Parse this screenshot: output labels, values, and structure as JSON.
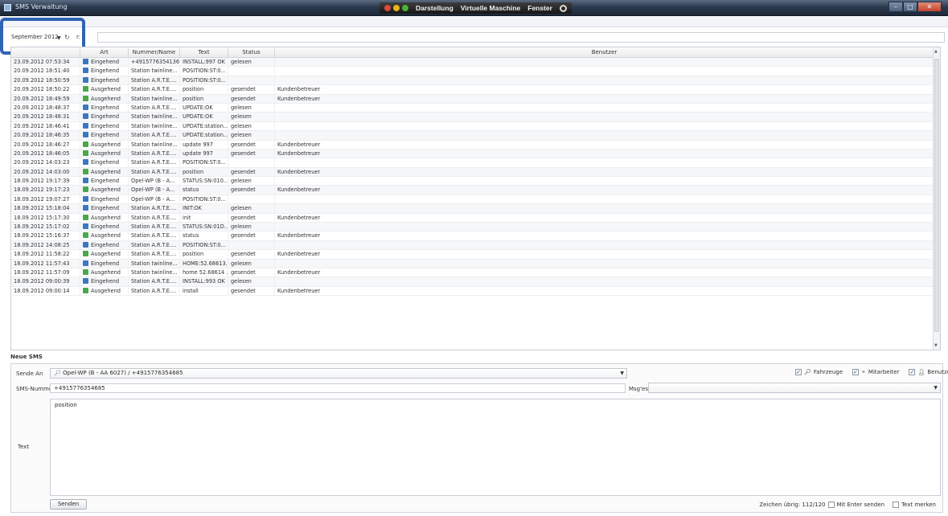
{
  "window": {
    "title": "SMS Verwaltung"
  },
  "host_menu": [
    "Darstellung",
    "Virtuelle Maschine",
    "Fenster"
  ],
  "host_menu_colors": [
    "#d84a3a",
    "#e6b21e",
    "#4caf3c"
  ],
  "filter": {
    "month": "September 2012",
    "label_partial": "r:",
    "value": ""
  },
  "table": {
    "columns": [
      "",
      "Art",
      "Nummer/Name",
      "Text",
      "Status",
      "Benutzer"
    ],
    "colors": {
      "Eingehend": "#3a78c2",
      "Ausgehend": "#4aa84c"
    },
    "rows": [
      [
        "23.09.2012 07:53:34",
        "Eingehend",
        "+4915776354136",
        "INSTALL:997 OK",
        "gelesen",
        ""
      ],
      [
        "20.09.2012 18:51:40",
        "Eingehend",
        "Station twinline...",
        "POSITION:ST:0...",
        "",
        ""
      ],
      [
        "20.09.2012 18:50:59",
        "Eingehend",
        "Station A.R.T.E....",
        "POSITION:ST:0...",
        "",
        ""
      ],
      [
        "20.09.2012 18:50:22",
        "Ausgehend",
        "Station A.R.T.E....",
        "position",
        "gesendet",
        "Kundenbetreuer"
      ],
      [
        "20.09.2012 18:49:59",
        "Ausgehend",
        "Station twinline...",
        "position",
        "gesendet",
        "Kundenbetreuer"
      ],
      [
        "20.09.2012 18:48:37",
        "Eingehend",
        "Station A.R.T.E....",
        "UPDATE:OK",
        "gelesen",
        ""
      ],
      [
        "20.09.2012 18:48:31",
        "Eingehend",
        "Station twinline...",
        "UPDATE:OK",
        "gelesen",
        ""
      ],
      [
        "20.09.2012 18:46:41",
        "Eingehend",
        "Station twinline...",
        "UPDATE:station...",
        "gelesen",
        ""
      ],
      [
        "20.09.2012 18:46:35",
        "Eingehend",
        "Station A.R.T.E....",
        "UPDATE:station...",
        "gelesen",
        ""
      ],
      [
        "20.09.2012 18:46:27",
        "Ausgehend",
        "Station twinline...",
        "update 997",
        "gesendet",
        "Kundenbetreuer"
      ],
      [
        "20.09.2012 18:46:05",
        "Ausgehend",
        "Station A.R.T.E....",
        "update 997",
        "gesendet",
        "Kundenbetreuer"
      ],
      [
        "20.09.2012 14:03:23",
        "Eingehend",
        "Station A.R.T.E....",
        "POSITION:ST:0...",
        "",
        ""
      ],
      [
        "20.09.2012 14:03:00",
        "Ausgehend",
        "Station A.R.T.E....",
        "position",
        "gesendet",
        "Kundenbetreuer"
      ],
      [
        "18.09.2012 19:17:39",
        "Eingehend",
        "Opel-WP (B - A...",
        "STATUS:SN:010...",
        "gelesen",
        ""
      ],
      [
        "18.09.2012 19:17:23",
        "Ausgehend",
        "Opel-WP (B - A...",
        "status",
        "gesendet",
        "Kundenbetreuer"
      ],
      [
        "18.09.2012 19:07:27",
        "Eingehend",
        "Opel-WP (B - A...",
        "POSITION:ST:0...",
        "",
        ""
      ],
      [
        "18.09.2012 15:18:04",
        "Eingehend",
        "Station A.R.T.E....",
        "INIT:OK",
        "gelesen",
        ""
      ],
      [
        "18.09.2012 15:17:30",
        "Ausgehend",
        "Station A.R.T.E....",
        "init",
        "gesendet",
        "Kundenbetreuer"
      ],
      [
        "18.09.2012 15:17:02",
        "Eingehend",
        "Station A.R.T.E....",
        "STATUS:SN:01D...",
        "gelesen",
        ""
      ],
      [
        "18.09.2012 15:16:37",
        "Ausgehend",
        "Station A.R.T.E....",
        "status",
        "gesendet",
        "Kundenbetreuer"
      ],
      [
        "18.09.2012 14:08:25",
        "Eingehend",
        "Station A.R.T.E....",
        "POSITION:ST:0...",
        "",
        ""
      ],
      [
        "18.09.2012 11:58:22",
        "Ausgehend",
        "Station A.R.T.E....",
        "position",
        "gesendet",
        "Kundenbetreuer"
      ],
      [
        "18.09.2012 11:57:43",
        "Eingehend",
        "Station twinline...",
        "HOME:52.68613...",
        "gelesen",
        ""
      ],
      [
        "18.09.2012 11:57:09",
        "Ausgehend",
        "Station twinline...",
        "home 52.68614 ...",
        "gesendet",
        "Kundenbetreuer"
      ],
      [
        "18.09.2012 09:00:39",
        "Eingehend",
        "Station A.R.T.E....",
        "INSTALL:993 OK",
        "gelesen",
        ""
      ],
      [
        "18.09.2012 09:00:14",
        "Ausgehend",
        "Station A.R.T.E....",
        "install",
        "gesendet",
        "Kundenbetreuer"
      ]
    ]
  },
  "neue_sms": {
    "section_title": "Neue SMS",
    "sende_an_label": "Sende An",
    "sende_an_value": "Opel-WP (B - AA 6027) / +4915776354685",
    "filters": [
      "Fahrzeuge",
      "Mitarbeiter",
      "Benutzer"
    ],
    "sms_nummer_label": "SMS-Nummer",
    "sms_nummer_value": "+4915776354685",
    "msgs_label": "Msg'es",
    "msgs_value": "",
    "text_label": "Text",
    "text_value": "position",
    "send_button": "Senden",
    "chars_left": "Zeichen übrig: 112/120",
    "enter_send_label": "Mit Enter senden",
    "remember_label": "Text merken"
  }
}
